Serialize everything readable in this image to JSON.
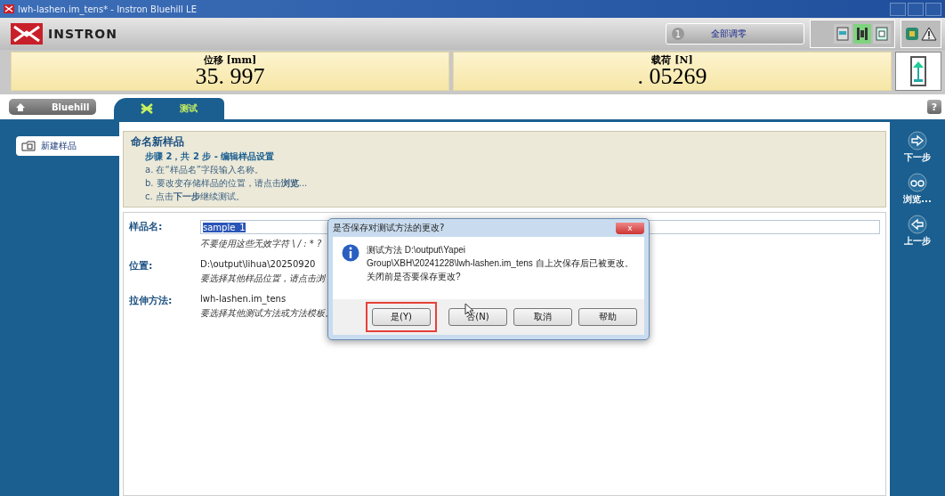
{
  "window": {
    "title": "lwh-lashen.im_tens* - Instron Bluehill LE"
  },
  "header": {
    "logo": "INSTRON",
    "status_button": {
      "number": "1",
      "label": "全部调零"
    },
    "tools": [
      {
        "kind": "panel",
        "active": false
      },
      {
        "kind": "fixture",
        "active": true
      },
      {
        "kind": "frame",
        "active": false
      }
    ],
    "alerts": [
      {
        "kind": "chip"
      },
      {
        "kind": "warning"
      }
    ]
  },
  "meters": [
    {
      "label": "位移 [mm]",
      "value": "35. 997"
    },
    {
      "label": "载荷 [N]",
      "value": ". 05269"
    }
  ],
  "tabs": [
    {
      "label": "Bluehill",
      "selected": false
    },
    {
      "label": "测试",
      "selected": true
    }
  ],
  "help_button": "?",
  "sidebar": {
    "items": [
      {
        "label": "新建样品",
        "selected": true
      }
    ]
  },
  "instructions": {
    "title": "命名新样品",
    "step": "步骤 2，共 2 步 - 编辑样品设置",
    "lines": [
      "a. 在“样品名”字段输入名称。",
      "b. 要改变存储样品的位置，请点击**浏览**...",
      "c. 点击**下一步**继续测试。"
    ]
  },
  "form": [
    {
      "label": "样品名:",
      "kind": "input",
      "value": "sample_1",
      "hint": "不要使用这些无效字符 \\ / : * ?"
    },
    {
      "label": "位置:",
      "kind": "text",
      "value": "D:\\output\\lihua\\20250920",
      "hint": "要选择其他样品位置，请点击浏"
    },
    {
      "label": "拉伸方法:",
      "kind": "text",
      "value": "lwh-lashen.im_tens",
      "hint": "要选择其他测试方法或方法模板。"
    }
  ],
  "nav": [
    {
      "kind": "next",
      "label": "下一步"
    },
    {
      "kind": "browse",
      "label": "浏览..."
    },
    {
      "kind": "back",
      "label": "上一步"
    }
  ],
  "dialog": {
    "title": "是否保存对测试方法的更改?",
    "close": "x",
    "message_lines": [
      "测试方法 D:\\output\\Yapei",
      "Group\\XBH\\20241228\\lwh-lashen.im_tens 自上次保存后已被更改。",
      "关闭前是否要保存更改?"
    ],
    "buttons": [
      {
        "label": "是(Y)",
        "highlighted": true
      },
      {
        "label": "否(N)",
        "highlighted": false
      },
      {
        "label": "取消",
        "highlighted": false
      },
      {
        "label": "帮助",
        "highlighted": false
      }
    ]
  }
}
